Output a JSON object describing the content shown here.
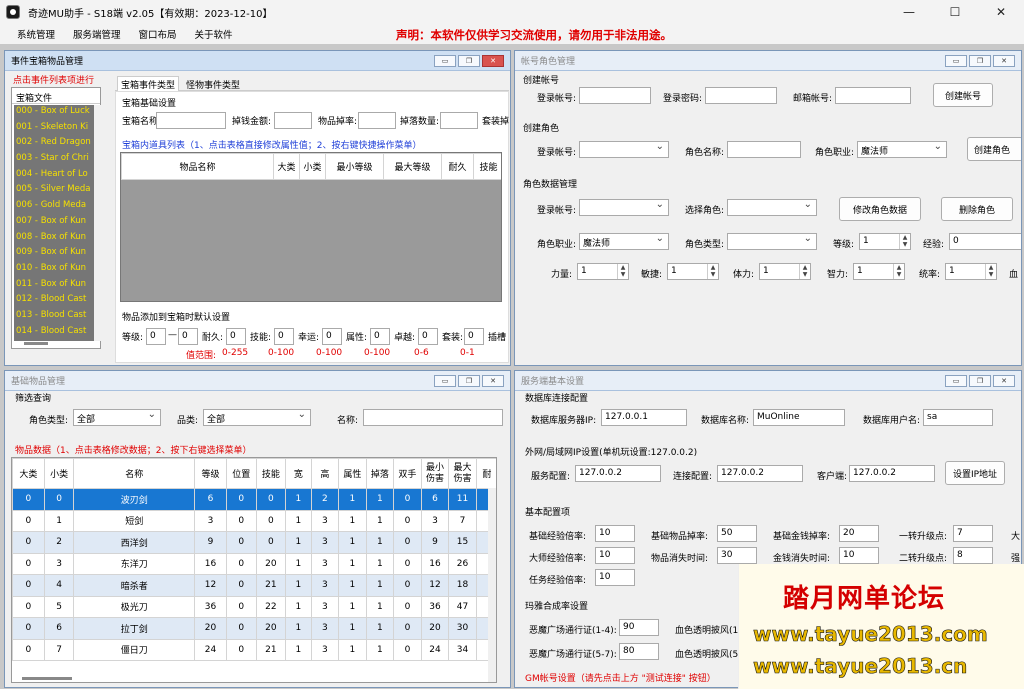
{
  "app": {
    "title": "奇迹MU助手 - S18端  v2.05【有效期：2023-12-10】",
    "disclaimer": "声明：本软件仅供学习交流使用，请勿用于非法用途。",
    "menu": [
      "系统管理",
      "服务端管理",
      "窗口布局",
      "关于软件"
    ],
    "window_controls": {
      "minimize": "—",
      "maximize": "☐",
      "close": "✕"
    }
  },
  "treasure": {
    "title": "事件宝箱物品管理",
    "hint": "点击事件列表项进行",
    "list_header": "宝箱文件",
    "list_items": [
      "000 - Box of Luck",
      "001 - Skeleton Ki",
      "002 - Red Dragon",
      "003 - Star of Chri",
      "004 - Heart of Lo",
      "005 - Silver Meda",
      "006 - Gold Meda",
      "007 - Box of Kun",
      "008 - Box of Kun",
      "009 - Box of Kun",
      "010 - Box of Kun",
      "011 - Box of Kun",
      "012 - Blood Cast",
      "013 - Blood Cast",
      "014 - Blood Cast"
    ],
    "tabs": [
      "宝箱事件类型",
      "怪物事件类型"
    ],
    "basic_group": "宝箱基础设置",
    "basic_fields": {
      "name": "宝箱名称:",
      "money": "掉钱金额:",
      "rate": "物品掉率:",
      "count": "掉落数量:",
      "set": "套装掉"
    },
    "items_caption": "宝箱内道具列表（1、点击表格直接修改属性值；2、按右键快捷操作菜单）",
    "columns": [
      "物品名称",
      "大类",
      "小类",
      "最小等级",
      "最大等级",
      "耐久",
      "技能"
    ],
    "default_group": "物品添加到宝箱时默认设置",
    "defaults": {
      "level_label": "等级:",
      "level_min": "0",
      "dash": "—",
      "level_max": "0",
      "dur_label": "耐久:",
      "dur": "0",
      "skill_label": "技能:",
      "skill": "0",
      "luck_label": "幸运:",
      "luck": "0",
      "attr_label": "属性:",
      "attr": "0",
      "exc_label": "卓越:",
      "exc": "0",
      "set_label": "套装:",
      "set": "0",
      "socket_label": "插槽"
    },
    "ranges": {
      "label": "值范围:",
      "level": "0-255",
      "dur": "0-100",
      "skill": "0-100",
      "luck": "0-100",
      "attr": "0-6",
      "exc": "0-1"
    }
  },
  "account": {
    "title": "帐号角色管理",
    "create_account": {
      "group": "创建帐号",
      "login_label": "登录帐号:",
      "pwd_label": "登录密码:",
      "email_label": "邮箱帐号:",
      "button": "创建帐号"
    },
    "create_char": {
      "group": "创建角色",
      "login_label": "登录帐号:",
      "name_label": "角色名称:",
      "class_label": "角色职业:",
      "class_value": "魔法师",
      "button": "创建角色"
    },
    "manage": {
      "group": "角色数据管理",
      "login_label": "登录帐号:",
      "select_label": "选择角色:",
      "modify_button": "修改角色数据",
      "delete_button": "删除角色",
      "class_label": "角色职业:",
      "class_value": "魔法师",
      "type_label": "角色类型:",
      "level_label": "等级:",
      "level": "1",
      "exp_label": "经验:",
      "exp": "0",
      "str_label": "力量:",
      "str": "1",
      "agi_label": "敏捷:",
      "agi": "1",
      "vit_label": "体力:",
      "vit": "1",
      "ene_label": "智力:",
      "ene": "1",
      "cmd_label": "统率:",
      "cmd": "1",
      "blood_label": "血"
    }
  },
  "items": {
    "title": "基础物品管理",
    "filter_group": "筛选查询",
    "type_label": "角色类型:",
    "type_value": "全部",
    "kind_label": "品类:",
    "kind_value": "全部",
    "name_label": "名称:",
    "caption": "物品数据（1、点击表格修改数据；2、按下右键选择菜单）",
    "columns": [
      "大类",
      "小类",
      "名称",
      "等级",
      "位置",
      "技能",
      "宽",
      "高",
      "属性",
      "掉落",
      "双手",
      "最小伤害",
      "最大伤害",
      "耐"
    ],
    "rows": [
      [
        "0",
        "0",
        "波刃剑",
        "6",
        "0",
        "0",
        "1",
        "2",
        "1",
        "1",
        "0",
        "6",
        "11"
      ],
      [
        "0",
        "1",
        "短剑",
        "3",
        "0",
        "0",
        "1",
        "3",
        "1",
        "1",
        "0",
        "3",
        "7"
      ],
      [
        "0",
        "2",
        "西洋剑",
        "9",
        "0",
        "0",
        "1",
        "3",
        "1",
        "1",
        "0",
        "9",
        "15"
      ],
      [
        "0",
        "3",
        "东洋刀",
        "16",
        "0",
        "20",
        "1",
        "3",
        "1",
        "1",
        "0",
        "16",
        "26"
      ],
      [
        "0",
        "4",
        "暗杀者",
        "12",
        "0",
        "21",
        "1",
        "3",
        "1",
        "1",
        "0",
        "12",
        "18"
      ],
      [
        "0",
        "5",
        "极光刀",
        "36",
        "0",
        "22",
        "1",
        "3",
        "1",
        "1",
        "0",
        "36",
        "47"
      ],
      [
        "0",
        "6",
        "拉丁剑",
        "20",
        "0",
        "20",
        "1",
        "3",
        "1",
        "1",
        "0",
        "20",
        "30"
      ],
      [
        "0",
        "7",
        "僵日刀",
        "24",
        "0",
        "21",
        "1",
        "3",
        "1",
        "1",
        "0",
        "24",
        "34"
      ]
    ]
  },
  "server": {
    "title": "服务端基本设置",
    "db_group": "数据库连接配置",
    "db": {
      "ip_label": "数据库服务器IP:",
      "ip": "127.0.0.1",
      "name_label": "数据库名称:",
      "name": "MuOnline",
      "user_label": "数据库用户名:",
      "user": "sa"
    },
    "net_group": "外网/局域网IP设置(单机玩设置:127.0.0.2)",
    "net": {
      "server_label": "服务配置:",
      "server": "127.0.0.2",
      "connect_label": "连接配置:",
      "connect": "127.0.0.2",
      "client_label": "客户端:",
      "client": "127.0.0.2",
      "button": "设置IP地址"
    },
    "basic_group": "基本配置项",
    "basic": {
      "exp_label": "基础经验倍率:",
      "exp": "10",
      "drop_label": "基础物品掉率:",
      "drop": "50",
      "money_label": "基础金钱掉率:",
      "money": "20",
      "up1_label": "一转升级点:",
      "up1": "7",
      "master_label": "大师经验倍率:",
      "master": "10",
      "vanish_label": "物品消失时间:",
      "vanish": "30",
      "mvanish_label": "金钱消失时间:",
      "mvanish": "10",
      "up2_label": "二转升级点:",
      "up2": "8",
      "quest_label": "任务经验倍率:",
      "quest": "10",
      "cut1": "大",
      "cut2": "强"
    },
    "mix_group": "玛雅合成率设置",
    "mix": {
      "dc1_label": "恶魔广场通行证(1-4):",
      "dc1": "90",
      "bc1_label": "血色透明披风(1-4",
      "dc2_label": "恶魔广场通行证(5-7):",
      "dc2": "80",
      "bc2_label": "血色透明披风(5"
    },
    "gm_label": "GM帐号设置（请先点击上方 \"测试连接\" 按钮）"
  },
  "watermark": {
    "line1": "踏月网单论坛",
    "line2": "www.tayue2013.com",
    "line3": "www.tayue2013.cn"
  },
  "pane_buttons": {
    "min": "▭",
    "restore": "❐",
    "close": "✕"
  }
}
